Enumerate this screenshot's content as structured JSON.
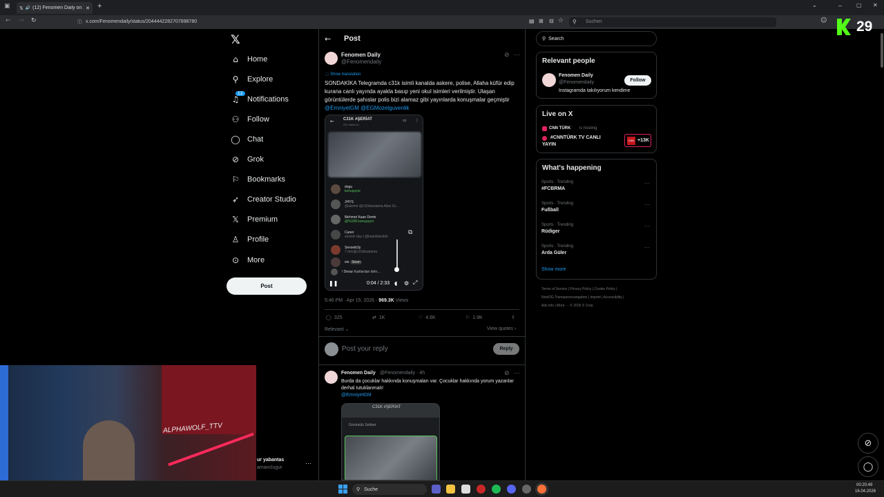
{
  "browser": {
    "tab_title": "(12) Fenomen Daily on X: \"S",
    "url": "x.com/Fenomendaily/status/2044442282707898780",
    "search_placeholder": "Suchen"
  },
  "nav": {
    "logo": "𝕏",
    "items": [
      {
        "icon": "home-icon",
        "label": "Home"
      },
      {
        "icon": "search-icon",
        "label": "Explore"
      },
      {
        "icon": "bell-icon",
        "label": "Notifications",
        "badge": "12"
      },
      {
        "icon": "follow-icon",
        "label": "Follow"
      },
      {
        "icon": "chat-icon",
        "label": "Chat"
      },
      {
        "icon": "grok-icon",
        "label": "Grok"
      },
      {
        "icon": "bookmark-icon",
        "label": "Bookmarks"
      },
      {
        "icon": "rocket-icon",
        "label": "Creator Studio"
      },
      {
        "icon": "x-icon",
        "label": "Premium"
      },
      {
        "icon": "profile-icon",
        "label": "Profile"
      },
      {
        "icon": "more-icon",
        "label": "More"
      }
    ],
    "post_button": "Post",
    "account_name": "ur yabantas",
    "account_handle": "amanclugur"
  },
  "post": {
    "header": "Post",
    "author": "Fenomen Daily",
    "handle": "@Fenomendaily",
    "show_translation": "Show translation",
    "text": "SONDAKİKA Telegramda c31k isimli kanalda askere, polise, Allaha küfür edip kurana canlı yayında ayakla basıp yeni okul isimleri verilmiştir. Ulaşan görüntülerde şahıslar polis bizi alamaz gibi yayınlarda konuşmalar geçmiştir",
    "mentions": "@EmniyetGM @EGMozelguvenlik",
    "timestamp": "5:46 PM · Apr 15, 2026 · ",
    "views_count": "969.3K",
    "views_label": " Views",
    "stats": {
      "replies": "325",
      "reposts": "1K",
      "likes": "4.6K",
      "bookmarks": "1.9K"
    },
    "relevant": "Relevant",
    "view_quotes": "View quotes",
    "reply_placeholder": "Post your reply",
    "reply_button": "Reply"
  },
  "media": {
    "channel": "C31K #ŞERİAT",
    "subtitle": "241 katılımcı",
    "participants": [
      {
        "name": "dogu",
        "status": "konuşuyor"
      },
      {
        "name": "JHYS",
        "status": "@alsimir @c31kbaslama Allas Gr..."
      },
      {
        "name": "Mehmet Kaan Demir",
        "status": "@%198 konuşuyor"
      },
      {
        "name": "Caner",
        "status": "sesinin dışı | @kaanklardrde"
      },
      {
        "name": "Senseib3y",
        "status": "7 mm@c31kbaslama"
      },
      {
        "name": "etx",
        "status": "Sinan"
      },
      {
        "name": "! Dexar",
        "status": "Karilardan birin..."
      }
    ],
    "time": "0:04 / 2:33"
  },
  "reply": {
    "author": "Fenomen Daily",
    "meta": "@Fenomendaily · 4h",
    "text": "Burda da çocuklar hakkında konuşmaları var. Çocuklar hakkında yorum yazanlar derhal tutuklanmalı!",
    "mention": "@EmniyetGM",
    "media_channel": "C31K #ŞERİAT",
    "media_tab": "Görüntülü Sohbet"
  },
  "right": {
    "search_placeholder": "Search",
    "relevant_title": "Relevant people",
    "person_name": "Fenomen Daily",
    "person_handle": "@Fenomendaily",
    "person_bio": "Instagramda takılıyorum kendime",
    "follow_button": "Follow",
    "live_title": "Live on X",
    "live_host": "CNN TÜRK",
    "live_hosting": "is hosting",
    "live_show": "#CNNTÜRK TV CANLI YAYIN",
    "live_count": "+13K",
    "happening_title": "What's happening",
    "trends": [
      {
        "meta": "Sports · Trending",
        "name": "#FCBRMA"
      },
      {
        "meta": "Sports · Trending",
        "name": "Fußball"
      },
      {
        "meta": "Sports · Trending",
        "name": "Rüdiger"
      },
      {
        "meta": "Sports · Trending",
        "name": "Arda Güler"
      }
    ],
    "show_more": "Show more",
    "footer_line1": "Terms of Service  |  Privacy Policy  |  Cookie Policy  |",
    "footer_line2": "NetzDG Transparenzangaben  |  Imprint  |  Accessibility  |",
    "footer_line3": "Ads info  |  More ···  © 2026 X Corp."
  },
  "overlay": {
    "kick_counter": "29",
    "webcam_text": "ALPHAWOLF_TTV",
    "taskbar_search": "Suche",
    "clock_time": "00:20:49",
    "clock_date": "16.04.2026"
  },
  "colors": {
    "accent": "#1d9bf0",
    "kick_green": "#53fc18",
    "live_red": "#e0245e"
  }
}
